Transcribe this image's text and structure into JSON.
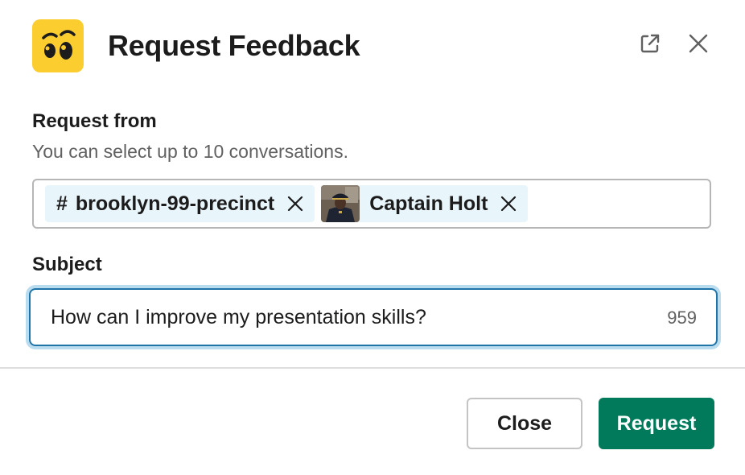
{
  "modal": {
    "title": "Request Feedback",
    "app_icon": "eyes-face-icon",
    "app_icon_color": "#fbcd2f",
    "actions": {
      "open_external_icon": "external-link-icon",
      "close_icon": "close-icon"
    }
  },
  "request_from": {
    "label": "Request from",
    "hint": "You can select up to 10 conversations.",
    "selected": [
      {
        "type": "channel",
        "prefix": "#",
        "label": "brooklyn-99-precinct"
      },
      {
        "type": "user",
        "label": "Captain Holt",
        "avatar": "user-avatar"
      }
    ]
  },
  "subject": {
    "label": "Subject",
    "value": "How can I improve my presentation skills?",
    "remaining_chars": "959"
  },
  "footer": {
    "close_label": "Close",
    "request_label": "Request",
    "request_color": "#007a5a"
  }
}
